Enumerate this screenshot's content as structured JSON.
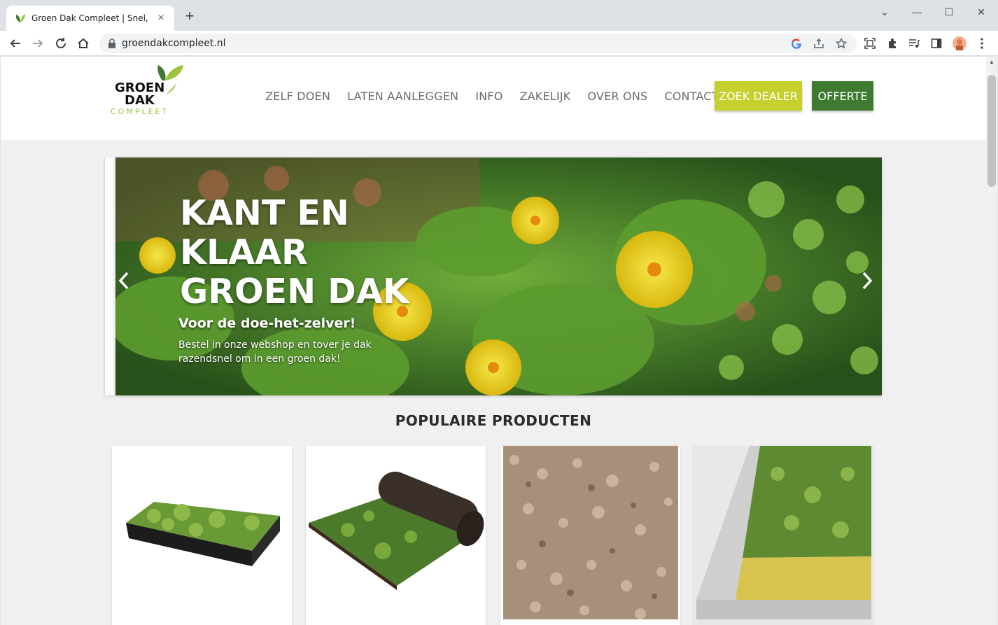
{
  "browser": {
    "tab_title": "Groen Dak Compleet | Snel, eenvoudig",
    "new_tab": "+",
    "url": "groendakcompleet.nl",
    "win_minimize": "—",
    "win_restore": "☐",
    "win_close": "✕",
    "tab_list": "⌄"
  },
  "site": {
    "logo": {
      "line1": "GROEN",
      "line2": "DAK",
      "line3": "COMPLEET"
    },
    "nav": [
      {
        "label": "ZELF DOEN"
      },
      {
        "label": "LATEN AANLEGGEN"
      },
      {
        "label": "INFO"
      },
      {
        "label": "ZAKELIJK"
      },
      {
        "label": "OVER ONS"
      },
      {
        "label": "CONTACT"
      }
    ],
    "dealer_button": "ZOEK DEALER",
    "offerte_button": "OFFERTE",
    "colors": {
      "dealer": "#c7cf2c",
      "offerte": "#3e7a2f"
    }
  },
  "hero": {
    "title": "KANT EN KLAAR GROEN DAK",
    "subtitle": "Voor de doe-het-zelver!",
    "text": "Bestel in onze webshop en tover je dak razendsnel om in een groen dak!"
  },
  "products": {
    "title": "POPULAIRE PRODUCTEN"
  }
}
